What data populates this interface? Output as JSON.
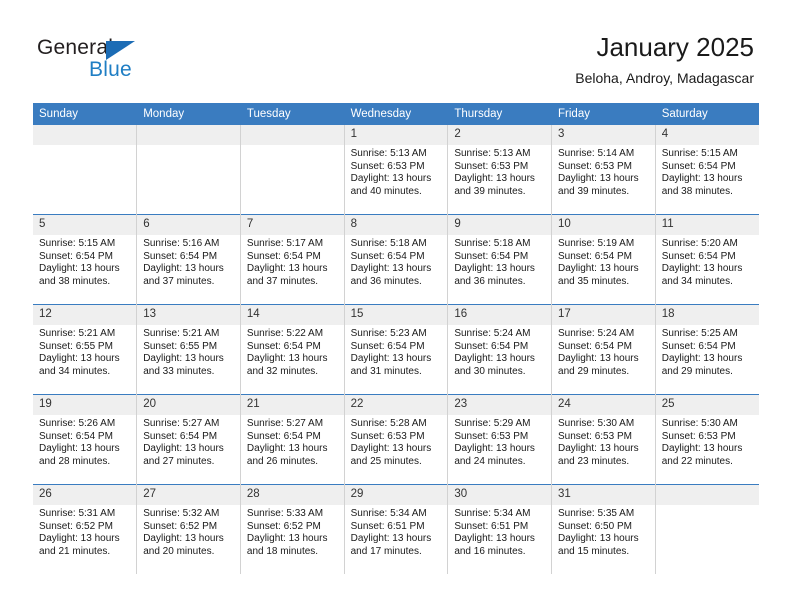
{
  "logo": {
    "text_primary": "General",
    "text_secondary": "Blue",
    "triangle_icon": "triangle-icon",
    "color_primary": "#231f20",
    "color_secondary": "#1f7ec4"
  },
  "header": {
    "title": "January 2025",
    "subtitle": "Beloha, Androy, Madagascar"
  },
  "theme": {
    "header_bg": "#3a7cc0",
    "daynum_bg": "#efefef",
    "grid_line": "#d2d2d2",
    "row_line": "#3a7cc0"
  },
  "weekdays": [
    "Sunday",
    "Monday",
    "Tuesday",
    "Wednesday",
    "Thursday",
    "Friday",
    "Saturday"
  ],
  "labels": {
    "sunrise_prefix": "Sunrise:",
    "sunset_prefix": "Sunset:",
    "daylight_prefix": "Daylight:"
  },
  "weeks": [
    [
      {
        "day": "",
        "sunrise": "",
        "sunset": "",
        "daylight_line1": "",
        "daylight_line2": ""
      },
      {
        "day": "",
        "sunrise": "",
        "sunset": "",
        "daylight_line1": "",
        "daylight_line2": ""
      },
      {
        "day": "",
        "sunrise": "",
        "sunset": "",
        "daylight_line1": "",
        "daylight_line2": ""
      },
      {
        "day": "1",
        "sunrise": "Sunrise: 5:13 AM",
        "sunset": "Sunset: 6:53 PM",
        "daylight_line1": "Daylight: 13 hours",
        "daylight_line2": "and 40 minutes."
      },
      {
        "day": "2",
        "sunrise": "Sunrise: 5:13 AM",
        "sunset": "Sunset: 6:53 PM",
        "daylight_line1": "Daylight: 13 hours",
        "daylight_line2": "and 39 minutes."
      },
      {
        "day": "3",
        "sunrise": "Sunrise: 5:14 AM",
        "sunset": "Sunset: 6:53 PM",
        "daylight_line1": "Daylight: 13 hours",
        "daylight_line2": "and 39 minutes."
      },
      {
        "day": "4",
        "sunrise": "Sunrise: 5:15 AM",
        "sunset": "Sunset: 6:54 PM",
        "daylight_line1": "Daylight: 13 hours",
        "daylight_line2": "and 38 minutes."
      }
    ],
    [
      {
        "day": "5",
        "sunrise": "Sunrise: 5:15 AM",
        "sunset": "Sunset: 6:54 PM",
        "daylight_line1": "Daylight: 13 hours",
        "daylight_line2": "and 38 minutes."
      },
      {
        "day": "6",
        "sunrise": "Sunrise: 5:16 AM",
        "sunset": "Sunset: 6:54 PM",
        "daylight_line1": "Daylight: 13 hours",
        "daylight_line2": "and 37 minutes."
      },
      {
        "day": "7",
        "sunrise": "Sunrise: 5:17 AM",
        "sunset": "Sunset: 6:54 PM",
        "daylight_line1": "Daylight: 13 hours",
        "daylight_line2": "and 37 minutes."
      },
      {
        "day": "8",
        "sunrise": "Sunrise: 5:18 AM",
        "sunset": "Sunset: 6:54 PM",
        "daylight_line1": "Daylight: 13 hours",
        "daylight_line2": "and 36 minutes."
      },
      {
        "day": "9",
        "sunrise": "Sunrise: 5:18 AM",
        "sunset": "Sunset: 6:54 PM",
        "daylight_line1": "Daylight: 13 hours",
        "daylight_line2": "and 36 minutes."
      },
      {
        "day": "10",
        "sunrise": "Sunrise: 5:19 AM",
        "sunset": "Sunset: 6:54 PM",
        "daylight_line1": "Daylight: 13 hours",
        "daylight_line2": "and 35 minutes."
      },
      {
        "day": "11",
        "sunrise": "Sunrise: 5:20 AM",
        "sunset": "Sunset: 6:54 PM",
        "daylight_line1": "Daylight: 13 hours",
        "daylight_line2": "and 34 minutes."
      }
    ],
    [
      {
        "day": "12",
        "sunrise": "Sunrise: 5:21 AM",
        "sunset": "Sunset: 6:55 PM",
        "daylight_line1": "Daylight: 13 hours",
        "daylight_line2": "and 34 minutes."
      },
      {
        "day": "13",
        "sunrise": "Sunrise: 5:21 AM",
        "sunset": "Sunset: 6:55 PM",
        "daylight_line1": "Daylight: 13 hours",
        "daylight_line2": "and 33 minutes."
      },
      {
        "day": "14",
        "sunrise": "Sunrise: 5:22 AM",
        "sunset": "Sunset: 6:54 PM",
        "daylight_line1": "Daylight: 13 hours",
        "daylight_line2": "and 32 minutes."
      },
      {
        "day": "15",
        "sunrise": "Sunrise: 5:23 AM",
        "sunset": "Sunset: 6:54 PM",
        "daylight_line1": "Daylight: 13 hours",
        "daylight_line2": "and 31 minutes."
      },
      {
        "day": "16",
        "sunrise": "Sunrise: 5:24 AM",
        "sunset": "Sunset: 6:54 PM",
        "daylight_line1": "Daylight: 13 hours",
        "daylight_line2": "and 30 minutes."
      },
      {
        "day": "17",
        "sunrise": "Sunrise: 5:24 AM",
        "sunset": "Sunset: 6:54 PM",
        "daylight_line1": "Daylight: 13 hours",
        "daylight_line2": "and 29 minutes."
      },
      {
        "day": "18",
        "sunrise": "Sunrise: 5:25 AM",
        "sunset": "Sunset: 6:54 PM",
        "daylight_line1": "Daylight: 13 hours",
        "daylight_line2": "and 29 minutes."
      }
    ],
    [
      {
        "day": "19",
        "sunrise": "Sunrise: 5:26 AM",
        "sunset": "Sunset: 6:54 PM",
        "daylight_line1": "Daylight: 13 hours",
        "daylight_line2": "and 28 minutes."
      },
      {
        "day": "20",
        "sunrise": "Sunrise: 5:27 AM",
        "sunset": "Sunset: 6:54 PM",
        "daylight_line1": "Daylight: 13 hours",
        "daylight_line2": "and 27 minutes."
      },
      {
        "day": "21",
        "sunrise": "Sunrise: 5:27 AM",
        "sunset": "Sunset: 6:54 PM",
        "daylight_line1": "Daylight: 13 hours",
        "daylight_line2": "and 26 minutes."
      },
      {
        "day": "22",
        "sunrise": "Sunrise: 5:28 AM",
        "sunset": "Sunset: 6:53 PM",
        "daylight_line1": "Daylight: 13 hours",
        "daylight_line2": "and 25 minutes."
      },
      {
        "day": "23",
        "sunrise": "Sunrise: 5:29 AM",
        "sunset": "Sunset: 6:53 PM",
        "daylight_line1": "Daylight: 13 hours",
        "daylight_line2": "and 24 minutes."
      },
      {
        "day": "24",
        "sunrise": "Sunrise: 5:30 AM",
        "sunset": "Sunset: 6:53 PM",
        "daylight_line1": "Daylight: 13 hours",
        "daylight_line2": "and 23 minutes."
      },
      {
        "day": "25",
        "sunrise": "Sunrise: 5:30 AM",
        "sunset": "Sunset: 6:53 PM",
        "daylight_line1": "Daylight: 13 hours",
        "daylight_line2": "and 22 minutes."
      }
    ],
    [
      {
        "day": "26",
        "sunrise": "Sunrise: 5:31 AM",
        "sunset": "Sunset: 6:52 PM",
        "daylight_line1": "Daylight: 13 hours",
        "daylight_line2": "and 21 minutes."
      },
      {
        "day": "27",
        "sunrise": "Sunrise: 5:32 AM",
        "sunset": "Sunset: 6:52 PM",
        "daylight_line1": "Daylight: 13 hours",
        "daylight_line2": "and 20 minutes."
      },
      {
        "day": "28",
        "sunrise": "Sunrise: 5:33 AM",
        "sunset": "Sunset: 6:52 PM",
        "daylight_line1": "Daylight: 13 hours",
        "daylight_line2": "and 18 minutes."
      },
      {
        "day": "29",
        "sunrise": "Sunrise: 5:34 AM",
        "sunset": "Sunset: 6:51 PM",
        "daylight_line1": "Daylight: 13 hours",
        "daylight_line2": "and 17 minutes."
      },
      {
        "day": "30",
        "sunrise": "Sunrise: 5:34 AM",
        "sunset": "Sunset: 6:51 PM",
        "daylight_line1": "Daylight: 13 hours",
        "daylight_line2": "and 16 minutes."
      },
      {
        "day": "31",
        "sunrise": "Sunrise: 5:35 AM",
        "sunset": "Sunset: 6:50 PM",
        "daylight_line1": "Daylight: 13 hours",
        "daylight_line2": "and 15 minutes."
      },
      {
        "day": "",
        "sunrise": "",
        "sunset": "",
        "daylight_line1": "",
        "daylight_line2": ""
      }
    ]
  ]
}
